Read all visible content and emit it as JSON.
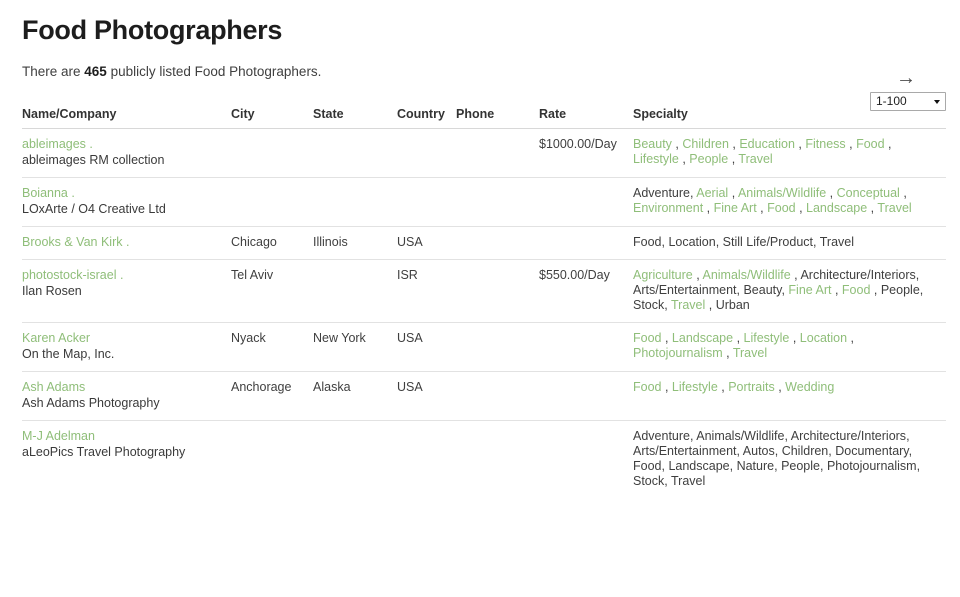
{
  "header": {
    "title": "Food Photographers",
    "summary_prefix": "There are ",
    "summary_count": "465",
    "summary_suffix": " publicly listed Food Photographers."
  },
  "pager": {
    "next_arrow_glyph": "→",
    "next_arrow_name": "next-page-arrow-icon",
    "range_value": "1-100",
    "range_options": [
      "1-100"
    ]
  },
  "colors": {
    "link_green": "#8fbe79",
    "text": "#3f3f3f",
    "heading": "#1d1d1d",
    "rule": "#e2e2e2"
  },
  "table": {
    "columns": [
      {
        "key": "name",
        "label": "Name/Company"
      },
      {
        "key": "city",
        "label": "City"
      },
      {
        "key": "state",
        "label": "State"
      },
      {
        "key": "country",
        "label": "Country"
      },
      {
        "key": "phone",
        "label": "Phone"
      },
      {
        "key": "rate",
        "label": "Rate"
      },
      {
        "key": "specialty",
        "label": "Specialty"
      }
    ],
    "rows": [
      {
        "name": "ableimages .",
        "company": "ableimages RM collection",
        "city": "",
        "state": "",
        "country": "",
        "phone": "",
        "rate": "$1000.00/Day",
        "specialty": [
          {
            "t": "Beauty",
            "link": true
          },
          {
            "t": "Children",
            "link": true
          },
          {
            "t": "Education",
            "link": true
          },
          {
            "t": "Fitness",
            "link": true
          },
          {
            "t": "Food",
            "link": true
          },
          {
            "t": "Lifestyle",
            "link": true
          },
          {
            "t": "People",
            "link": true
          },
          {
            "t": "Travel",
            "link": true
          }
        ]
      },
      {
        "name": "Boianna .",
        "company": "LOxArte / O4 Creative Ltd",
        "city": "",
        "state": "",
        "country": "",
        "phone": "",
        "rate": "",
        "specialty": [
          {
            "t": "Adventure",
            "link": false
          },
          {
            "t": "Aerial",
            "link": true
          },
          {
            "t": "Animals/Wildlife",
            "link": true
          },
          {
            "t": "Conceptual",
            "link": true
          },
          {
            "t": "Environment",
            "link": true
          },
          {
            "t": "Fine Art",
            "link": true
          },
          {
            "t": "Food",
            "link": true
          },
          {
            "t": "Landscape",
            "link": true
          },
          {
            "t": "Travel",
            "link": true
          }
        ]
      },
      {
        "name": "Brooks & Van Kirk .",
        "company": "",
        "city": "Chicago",
        "state": "Illinois",
        "country": "USA",
        "phone": "",
        "rate": "",
        "specialty": [
          {
            "t": "Food",
            "link": false
          },
          {
            "t": "Location",
            "link": false
          },
          {
            "t": "Still Life/Product",
            "link": false
          },
          {
            "t": "Travel",
            "link": false
          }
        ]
      },
      {
        "name": "photostock-israel .",
        "company": "Ilan Rosen",
        "city": "Tel Aviv",
        "state": "",
        "country": "ISR",
        "phone": "",
        "rate": "$550.00/Day",
        "specialty": [
          {
            "t": "Agriculture",
            "link": true
          },
          {
            "t": "Animals/Wildlife",
            "link": true
          },
          {
            "t": "Architecture/Interiors",
            "link": false
          },
          {
            "t": "Arts/Entertainment",
            "link": false
          },
          {
            "t": "Beauty",
            "link": false
          },
          {
            "t": "Fine Art",
            "link": true
          },
          {
            "t": "Food",
            "link": true
          },
          {
            "t": "People",
            "link": false
          },
          {
            "t": "Stock",
            "link": false
          },
          {
            "t": "Travel",
            "link": true
          },
          {
            "t": "Urban",
            "link": false
          }
        ]
      },
      {
        "name": "Karen Acker",
        "company": "On the Map, Inc.",
        "city": "Nyack",
        "state": "New York",
        "country": "USA",
        "phone": "",
        "rate": "",
        "specialty": [
          {
            "t": "Food",
            "link": true
          },
          {
            "t": "Landscape",
            "link": true
          },
          {
            "t": "Lifestyle",
            "link": true
          },
          {
            "t": "Location",
            "link": true
          },
          {
            "t": "Photojournalism",
            "link": true
          },
          {
            "t": "Travel",
            "link": true
          }
        ]
      },
      {
        "name": "Ash Adams",
        "company": "Ash Adams Photography",
        "city": "Anchorage",
        "state": "Alaska",
        "country": "USA",
        "phone": "",
        "rate": "",
        "specialty": [
          {
            "t": "Food",
            "link": true
          },
          {
            "t": "Lifestyle",
            "link": true
          },
          {
            "t": "Portraits",
            "link": true
          },
          {
            "t": "Wedding",
            "link": true
          }
        ]
      },
      {
        "name": "M-J Adelman",
        "company": "aLeoPics Travel Photography",
        "city": "",
        "state": "",
        "country": "",
        "phone": "",
        "rate": "",
        "specialty": [
          {
            "t": "Adventure",
            "link": false
          },
          {
            "t": "Animals/Wildlife",
            "link": false
          },
          {
            "t": "Architecture/Interiors",
            "link": false
          },
          {
            "t": "Arts/Entertainment",
            "link": false
          },
          {
            "t": "Autos",
            "link": false
          },
          {
            "t": "Children",
            "link": false
          },
          {
            "t": "Documentary",
            "link": false
          },
          {
            "t": "Food",
            "link": false
          },
          {
            "t": "Landscape",
            "link": false
          },
          {
            "t": "Nature",
            "link": false
          },
          {
            "t": "People",
            "link": false
          },
          {
            "t": "Photojournalism",
            "link": false
          },
          {
            "t": "Stock",
            "link": false
          },
          {
            "t": "Travel",
            "link": false
          }
        ]
      }
    ]
  }
}
